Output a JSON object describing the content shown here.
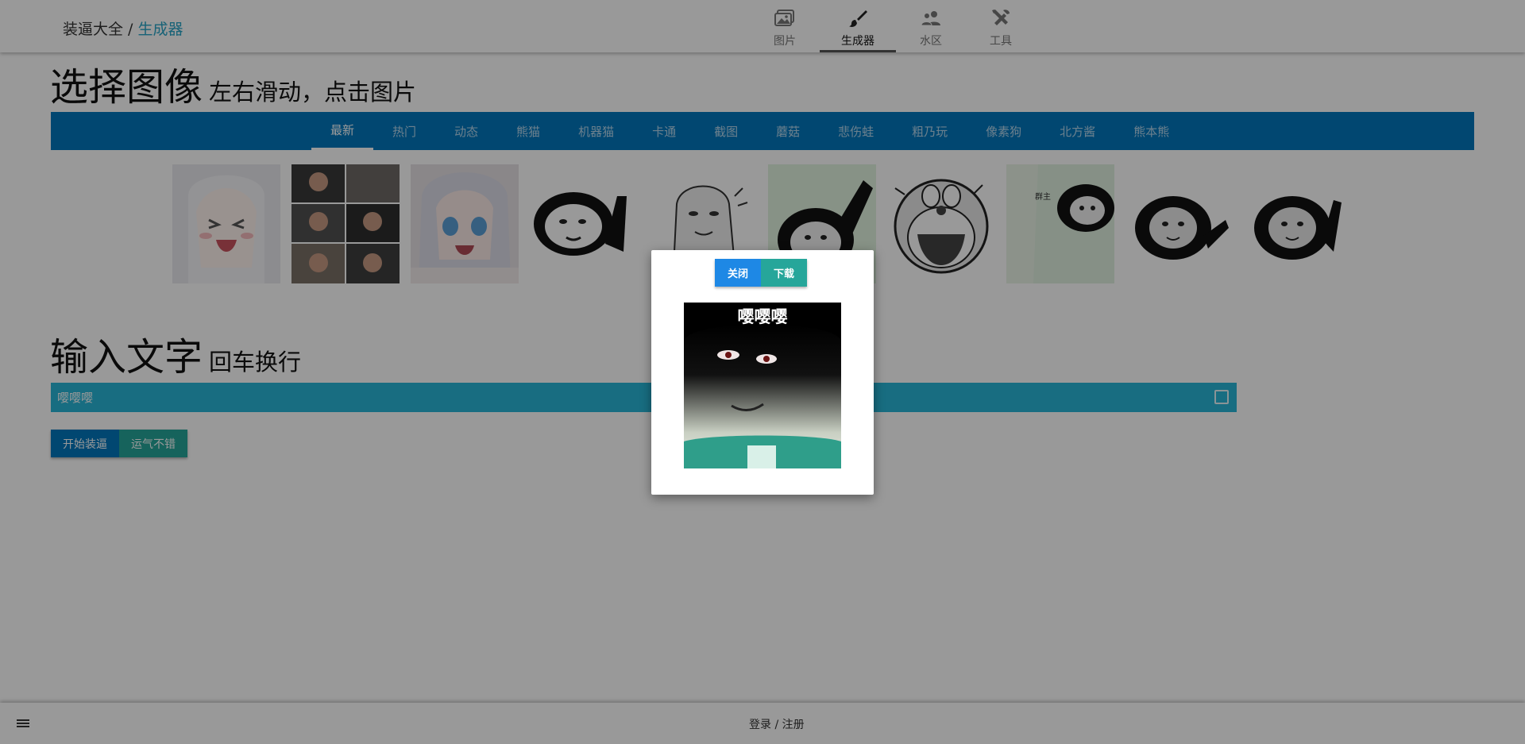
{
  "header": {
    "brand_root": "装逼大全",
    "separator": " / ",
    "brand_current": "生成器",
    "nav": [
      {
        "label": "图片",
        "icon": "image-icon"
      },
      {
        "label": "生成器",
        "icon": "brush-icon"
      },
      {
        "label": "水区",
        "icon": "users-icon"
      },
      {
        "label": "工具",
        "icon": "tools-icon"
      }
    ],
    "active_nav": "生成器"
  },
  "select_section": {
    "title": "选择图像",
    "subtitle": "左右滑动，点击图片"
  },
  "categories": [
    "最新",
    "热门",
    "动态",
    "熊猫",
    "机器猫",
    "卡通",
    "截图",
    "蘑菇",
    "悲伤蛙",
    "粗乃玩",
    "像素狗",
    "北方酱",
    "熊本熊"
  ],
  "active_category": "最新",
  "thumbnails": [
    {
      "name": "anime-girl-crying"
    },
    {
      "name": "man-collage"
    },
    {
      "name": "anime-girl-shocked"
    },
    {
      "name": "panda-pointing-up"
    },
    {
      "name": "mushroom-head-sketch"
    },
    {
      "name": "panda-green-bg"
    },
    {
      "name": "doraemon-shouting"
    },
    {
      "name": "panda-group-owner"
    },
    {
      "name": "panda-arm-out"
    },
    {
      "name": "panda-pointing"
    }
  ],
  "thumbnail_8_text": "群主",
  "text_section": {
    "title": "输入文字",
    "subtitle": "回车换行",
    "input_value": "嘤嘤嘤"
  },
  "buttons": {
    "start": "开始装逼",
    "lucky": "运气不错"
  },
  "footer": {
    "login": "登录 / 注册"
  },
  "modal": {
    "close": "关闭",
    "download": "下载",
    "caption": "嘤嘤嘤"
  },
  "colors": {
    "primary": "#0277bd",
    "secondary": "#26a69a",
    "input": "#29b6d8",
    "link": "#27a3c6"
  }
}
